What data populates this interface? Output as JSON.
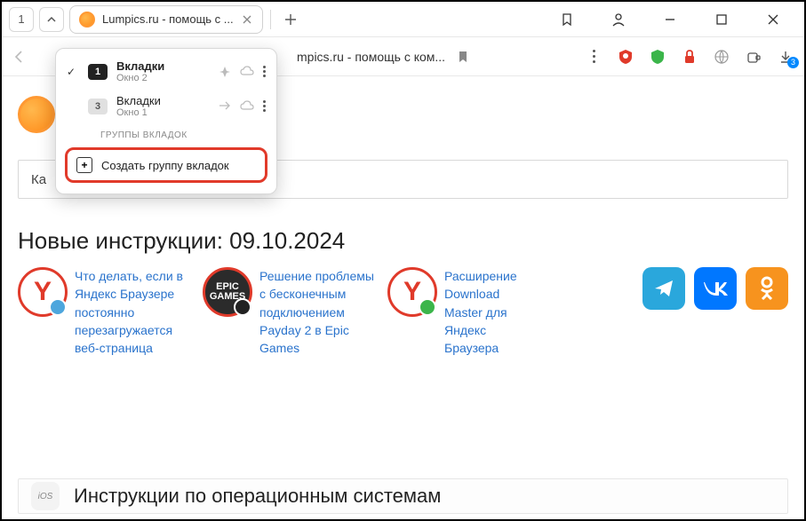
{
  "tabbar": {
    "counter": "1",
    "active_tab_title": "Lumpics.ru - помощь с ..."
  },
  "addressbar": {
    "url_text": "mpics.ru - помощь с ком...",
    "download_badge": "3"
  },
  "dropdown": {
    "items": [
      {
        "count": "1",
        "title": "Вкладки",
        "subtitle": "Окно 2",
        "active": true
      },
      {
        "count": "3",
        "title": "Вкладки",
        "subtitle": "Окно 1",
        "active": false
      }
    ],
    "section_label": "ГРУППЫ ВКЛАДОК",
    "create_label": "Создать группу вкладок"
  },
  "page": {
    "search_fragment_left": "Ка",
    "search_fragment_right": "?",
    "heading": "Новые инструкции: 09.10.2024",
    "cards": [
      {
        "text": "Что делать, если в Яндекс Браузере постоянно перезагружается веб-страница"
      },
      {
        "text": "Решение проблемы с бесконечным подключением Payday 2 в Epic Games"
      },
      {
        "text": "Расширение Download Master для Яндекс Браузера"
      }
    ],
    "epic_line1": "EPIC",
    "epic_line2": "GAMES",
    "ios_label": "iOS",
    "bottom_heading": "Инструкции по операционным системам"
  }
}
